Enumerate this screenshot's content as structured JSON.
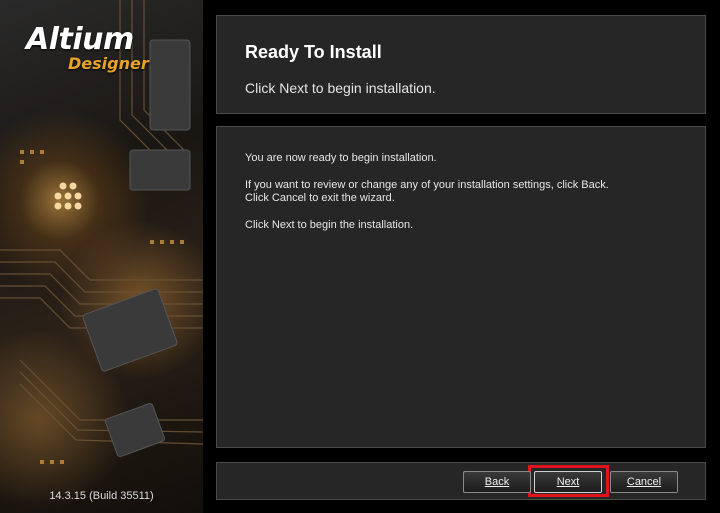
{
  "branding": {
    "logo_word": "Altium",
    "logo_sub": "Designer",
    "version": "14.3.15 (Build 35511)"
  },
  "header": {
    "title": "Ready To Install",
    "subtitle": "Click Next to begin installation."
  },
  "body": {
    "line1": "You are now ready to begin installation.",
    "line2": "If you want to review or change any of your installation settings, click Back.",
    "line3": "Click Cancel to exit the wizard.",
    "line4": "Click Next to begin the installation."
  },
  "footer": {
    "back_label": "Back",
    "next_label": "Next",
    "cancel_label": "Cancel"
  },
  "colors": {
    "accent_orange": "#e9a327",
    "highlight_red": "#e0141c",
    "panel_bg": "#262626"
  }
}
